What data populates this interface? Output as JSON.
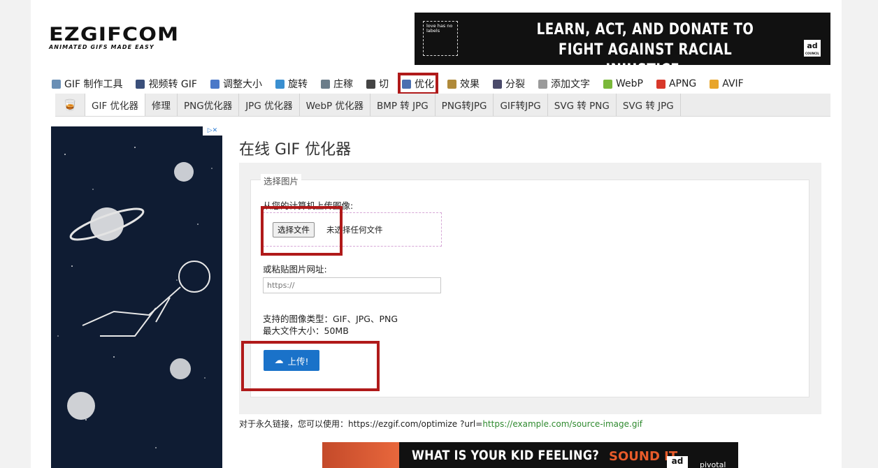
{
  "logo": {
    "main": "EZGIFCOM",
    "tagline": "ANIMATED GIFS MADE EASY"
  },
  "top_ad": {
    "box_text": "love has no labels",
    "line1": "LEARN, ACT, AND DONATE TO",
    "line2": "FIGHT AGAINST RACIAL INJUSTICE.",
    "logo_text": "ad",
    "logo_sub": "COUNCIL"
  },
  "main_nav": [
    {
      "label": "GIF 制作工具",
      "icon": "gif-maker-icon",
      "color": "#6a8fb5"
    },
    {
      "label": "视频转 GIF",
      "icon": "video-icon",
      "color": "#3a4f7a"
    },
    {
      "label": "调整大小",
      "icon": "resize-icon",
      "color": "#4a78c8"
    },
    {
      "label": "旋转",
      "icon": "rotate-icon",
      "color": "#3a8fd0"
    },
    {
      "label": "庄稼",
      "icon": "crop-icon",
      "color": "#6b7d8a"
    },
    {
      "label": "切",
      "icon": "cut-icon",
      "color": "#444444"
    },
    {
      "label": "优化",
      "icon": "optimize-icon",
      "color": "#4a6fb0"
    },
    {
      "label": "效果",
      "icon": "effects-icon",
      "color": "#b08a3a"
    },
    {
      "label": "分裂",
      "icon": "split-icon",
      "color": "#4a4a6a"
    },
    {
      "label": "添加文字",
      "icon": "text-icon",
      "color": "#9a9a9a"
    },
    {
      "label": "WebP",
      "icon": "webp-icon",
      "color": "#7ab83a"
    },
    {
      "label": "APNG",
      "icon": "apng-icon",
      "color": "#d8382a"
    },
    {
      "label": "AVIF",
      "icon": "avif-icon",
      "color": "#e8a52a"
    }
  ],
  "sub_nav": {
    "home_icon": "🥃",
    "items": [
      "GIF 优化器",
      "修理",
      "PNG优化器",
      "JPG 优化器",
      "WebP 优化器",
      "BMP 转 JPG",
      "PNG转JPG",
      "GIF转JPG",
      "SVG 转 PNG",
      "SVG 转 JPG"
    ]
  },
  "side_ad": {
    "adchoices": "▷✕"
  },
  "content": {
    "title": "在线 GIF 优化器",
    "legend": "选择图片",
    "upload_label": "从您的计算机上传图像:",
    "choose_button": "选择文件",
    "no_file": "未选择任何文件",
    "paste_label": "或粘贴图片网址:",
    "url_placeholder": "https://",
    "supported": "支持的图像类型：GIF、JPG、PNG",
    "max_size": "最大文件大小：50MB",
    "upload_button": "上传!"
  },
  "permalink": {
    "prefix": "对于永久链接，您可以使用：https://ezgif.com/optimize ?url=",
    "example": "https://example.com/source-image.gif"
  },
  "bottom_ad": {
    "headline": "WHAT IS YOUR KID FEELING?",
    "sound": "SOUND IT",
    "ad_logo": "ad",
    "brand": "pivotal"
  },
  "colors": {
    "highlight_red": "#b01a1a",
    "upload_blue": "#1a72c9",
    "link_green": "#2f8a2f"
  }
}
